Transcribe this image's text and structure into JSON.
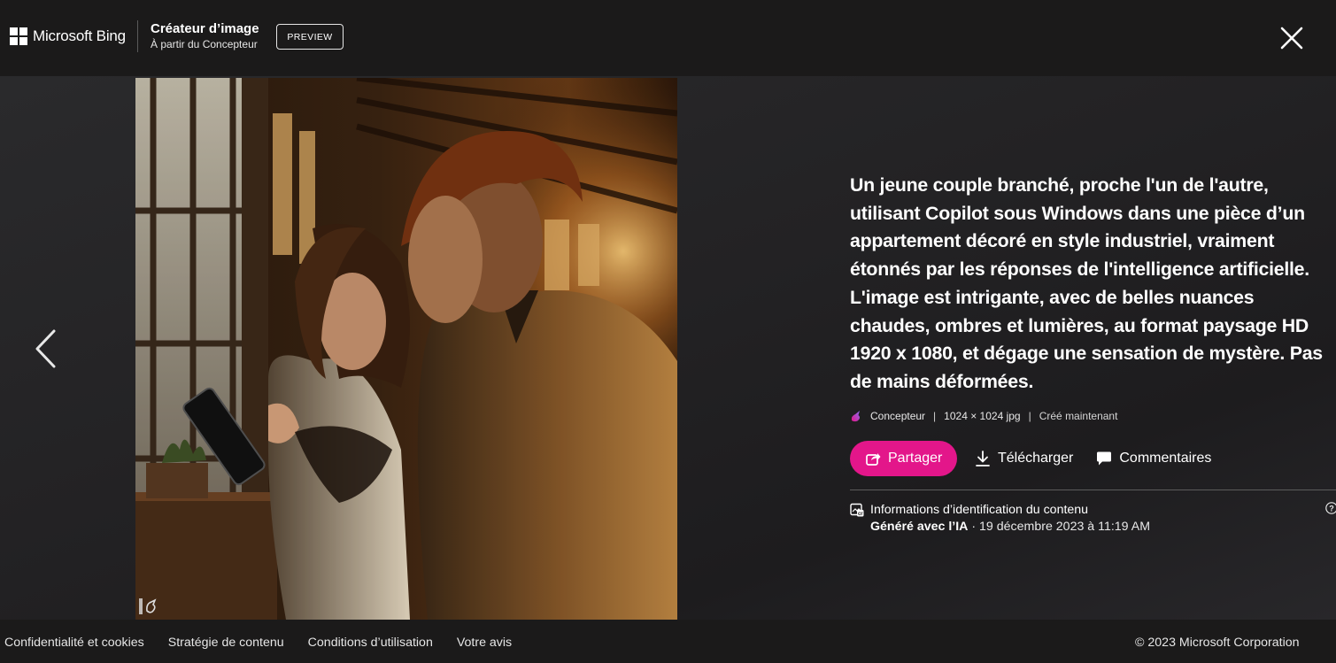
{
  "header": {
    "brand": "Microsoft Bing",
    "app_title": "Créateur d’image",
    "app_subtitle": "À partir du Concepteur",
    "badge": "PREVIEW"
  },
  "image": {
    "alt": "Un jeune couple branché, proche l'un de l'autre, utilisant Copilot sous Windows dans une pièce d’un appartement décoré en style industriel"
  },
  "details": {
    "prompt": "Un jeune couple branché, proche l'un de l'autre, utilisant Copilot sous Windows dans une pièce d’un appartement décoré en style industriel, vraiment étonnés par les réponses de l'intelligence artificielle. L'image est intrigante, avec de belles nuances chaudes, ombres et lumières, au format paysage HD 1920 x 1080, et dégage une sensation de mystère. Pas de mains déformées.",
    "source": "Concepteur",
    "separator": "|",
    "dimensions": "1024 × 1024 jpg",
    "created": "Créé maintenant",
    "share_label": "Partager",
    "download_label": "Télécharger",
    "comments_label": "Commentaires",
    "credentials_title": "Informations d’identification du contenu",
    "generated_label": "Généré avec l’IA",
    "generated_date": " · 19 décembre 2023 à 11:19 AM"
  },
  "footer": {
    "links": [
      "Confidentialité et cookies",
      "Stratégie de contenu",
      "Conditions d’utilisation",
      "Votre avis"
    ],
    "copyright": "© 2023 Microsoft Corporation"
  },
  "colors": {
    "accent": "#e3168a",
    "background": "#1b1a1a"
  },
  "icons": [
    "microsoft-logo-icon",
    "close-icon",
    "chevron-left-icon",
    "designer-icon",
    "share-icon",
    "download-icon",
    "comment-icon",
    "content-credentials-icon",
    "help-icon"
  ]
}
